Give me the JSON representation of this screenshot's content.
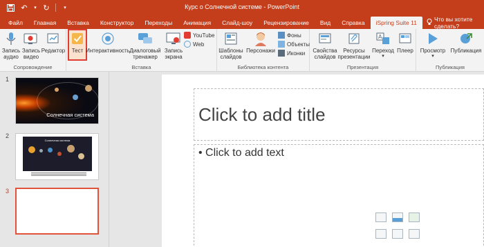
{
  "window": {
    "title": "Курс о Солнечной системе  -  PowerPoint"
  },
  "quick_access": [
    "save-icon",
    "undo-icon",
    "redo-icon",
    "customize-icon"
  ],
  "tabs": [
    {
      "label": "Файл",
      "active": false
    },
    {
      "label": "Главная",
      "active": false
    },
    {
      "label": "Вставка",
      "active": false
    },
    {
      "label": "Конструктор",
      "active": false
    },
    {
      "label": "Переходы",
      "active": false
    },
    {
      "label": "Анимация",
      "active": false
    },
    {
      "label": "Слайд-шоу",
      "active": false
    },
    {
      "label": "Рецензирование",
      "active": false
    },
    {
      "label": "Вид",
      "active": false
    },
    {
      "label": "Справка",
      "active": false
    },
    {
      "label": "iSpring Suite 11",
      "active": true
    }
  ],
  "tell_me": "Что вы хотите сделать?",
  "ribbon": {
    "groups": {
      "recording": "Сопровождение",
      "insert": "Вставка",
      "library": "Библиотека контента",
      "presentation": "Презентация",
      "publish": "Публикация"
    },
    "buttons": {
      "record_audio": "Запись аудио",
      "record_video": "Запись видео",
      "editor": "Редактор",
      "test": "Тест",
      "interactivity": "Интерактивность",
      "dialog_trainer": "Диалоговый тренажер",
      "screen_record": "Запись экрана",
      "youtube": "YouTube",
      "web": "Web",
      "slide_templates": "Шаблоны слайдов",
      "characters": "Персонажи",
      "backgrounds": "Фоны",
      "objects": "Объекты",
      "icons": "Иконки",
      "slide_props": "Свойства слайдов",
      "resources": "Ресурсы презентации",
      "navigation": "Переход",
      "player": "Плеер",
      "preview": "Просмотр",
      "publish": "Публикация"
    }
  },
  "thumbnails": [
    {
      "number": "1",
      "caption": "Солнечная система"
    },
    {
      "number": "2",
      "title": "Солнечная система"
    },
    {
      "number": "3"
    }
  ],
  "slide": {
    "title_placeholder": "Click to add title",
    "body_placeholder": "• Click to add text"
  },
  "colors": {
    "accent": "#c43e1c",
    "highlight_border": "#e03c31"
  }
}
